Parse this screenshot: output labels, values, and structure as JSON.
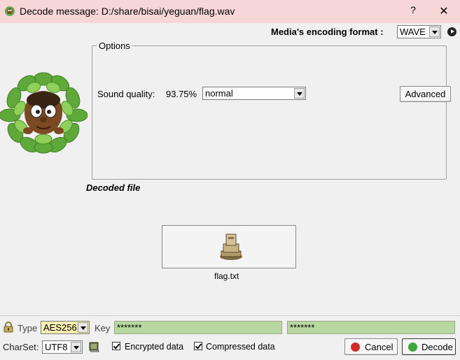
{
  "window": {
    "title": "Decode message: D:/share/bisai/yeguan/flag.wav",
    "help_label": "?",
    "close_label": "✕"
  },
  "encoding": {
    "label": "Media's encoding format :",
    "selected": "WAVE"
  },
  "options": {
    "legend": "Options",
    "sound_quality_label": "Sound quality:",
    "sound_quality_value": "93.75%",
    "quality_selected": "normal",
    "advanced_label": "Advanced"
  },
  "decoded": {
    "title": "Decoded file",
    "file_name": "flag.txt"
  },
  "crypto": {
    "type_label": "Type",
    "type_selected": "AES256",
    "key_label": "Key",
    "key_value": "*******",
    "key_confirm_value": "*******"
  },
  "bottom": {
    "charset_label": "CharSet:",
    "charset_selected": "UTF8",
    "encrypted_label": "Encrypted data",
    "encrypted_checked": true,
    "compressed_label": "Compressed data",
    "compressed_checked": true,
    "cancel_label": "Cancel",
    "decode_label": "Decode"
  },
  "colors": {
    "titlebar": "#f6d6d6",
    "key_field": "#b9d7a0",
    "type_select": "#f5efb0"
  }
}
